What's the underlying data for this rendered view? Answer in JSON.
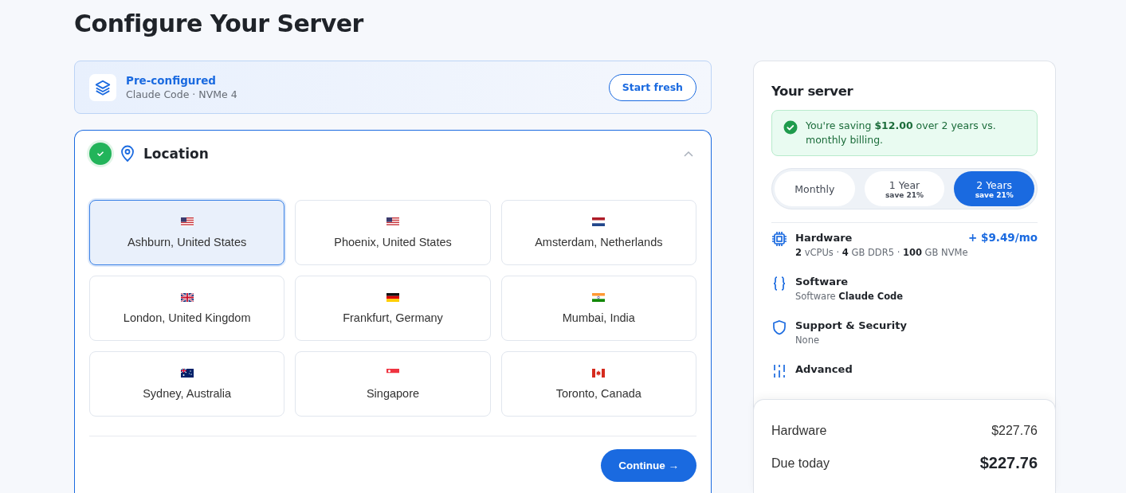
{
  "page_title": "Configure Your Server",
  "preset": {
    "title": "Pre-configured",
    "subtitle": "Claude Code · NVMe 4",
    "button": "Start fresh"
  },
  "step": {
    "title": "Location",
    "completed": true,
    "expanded": true,
    "locations": [
      {
        "name": "Ashburn, United States",
        "kind": "us",
        "selected": true
      },
      {
        "name": "Phoenix, United States",
        "kind": "us",
        "selected": false
      },
      {
        "name": "Amsterdam, Netherlands",
        "kind": "nl",
        "selected": false
      },
      {
        "name": "London, United Kingdom",
        "kind": "gb",
        "selected": false
      },
      {
        "name": "Frankfurt, Germany",
        "kind": "de",
        "selected": false
      },
      {
        "name": "Mumbai, India",
        "kind": "in",
        "selected": false
      },
      {
        "name": "Sydney, Australia",
        "kind": "au",
        "selected": false
      },
      {
        "name": "Singapore",
        "kind": "sg",
        "selected": false
      },
      {
        "name": "Toronto, Canada",
        "kind": "ca",
        "selected": false
      }
    ],
    "button": "Continue →"
  },
  "summary": {
    "title": "Your server",
    "savings": "You're saving **$12.00** over 2 years vs. monthly billing.",
    "billing": [
      {
        "label": "Monthly",
        "selected": false
      },
      {
        "label": "1 Year",
        "note": "save 21%",
        "selected": false
      },
      {
        "label": "2 Years",
        "note": "save 21%",
        "selected": true
      }
    ],
    "items": [
      {
        "kind": "chip",
        "title": "Hardware",
        "price": "+ $9.49/mo",
        "detail": "**2** vCPUs · **4** GB DDR5 · **100** GB NVMe"
      },
      {
        "kind": "braces",
        "title": "Software",
        "detail": "Software **Claude Code**"
      },
      {
        "kind": "shield",
        "title": "Support & Security",
        "detail": "None"
      },
      {
        "kind": "sliders",
        "title": "Advanced"
      }
    ],
    "totals": [
      {
        "label": "Hardware",
        "value": "$227.76",
        "kind": "line"
      },
      {
        "label": "Due today",
        "value": "$227.76",
        "kind": "total"
      }
    ]
  }
}
